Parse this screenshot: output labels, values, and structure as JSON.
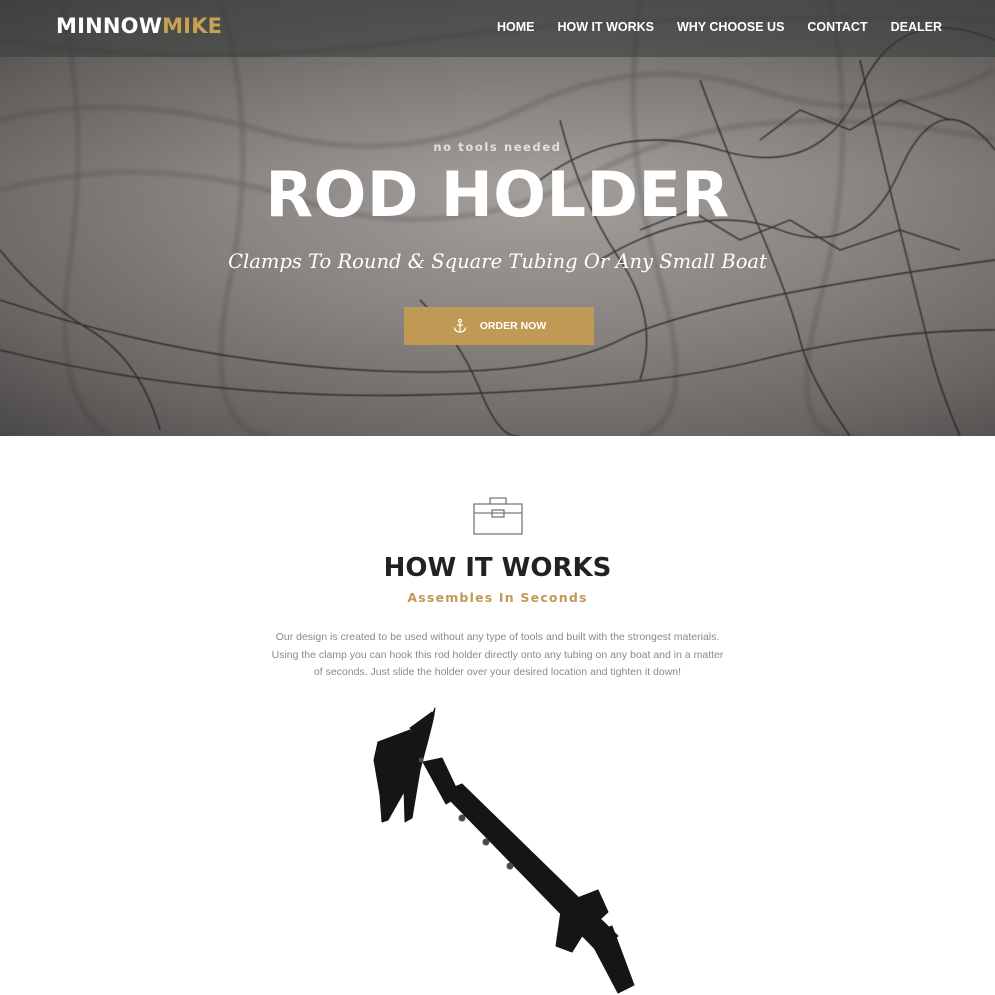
{
  "navbar": {
    "logo": {
      "part1": "MINNOW",
      "part2": "MIKE"
    },
    "items": [
      {
        "label": "HOME"
      },
      {
        "label": "HOW IT WORKS"
      },
      {
        "label": "WHY CHOOSE US"
      },
      {
        "label": "CONTACT"
      },
      {
        "label": "DEALER"
      }
    ]
  },
  "hero": {
    "eyebrow": "no tools needed",
    "title": "ROD HOLDER",
    "subtitle": "Clamps To Round & Square Tubing Or Any Small Boat",
    "cta": {
      "label": "ORDER NOW",
      "icon": "anchor-icon"
    },
    "background": "fishing-net-photo"
  },
  "how_it_works": {
    "icon": "toolbox-icon",
    "title": "HOW IT WORKS",
    "subtitle": "Assembles In Seconds",
    "description": "Our design is created to be used without any type of tools and built with the strongest materials. Using the clamp you can hook this rod holder directly onto any tubing on any boat and in a matter of seconds. Just slide the holder over your desired location and tighten it down!",
    "image": "rod-holder-product-photo"
  },
  "colors": {
    "accent": "#c09a55",
    "heading": "#222222",
    "body_text": "#8a8a8a",
    "nav_text": "#ffffff"
  }
}
